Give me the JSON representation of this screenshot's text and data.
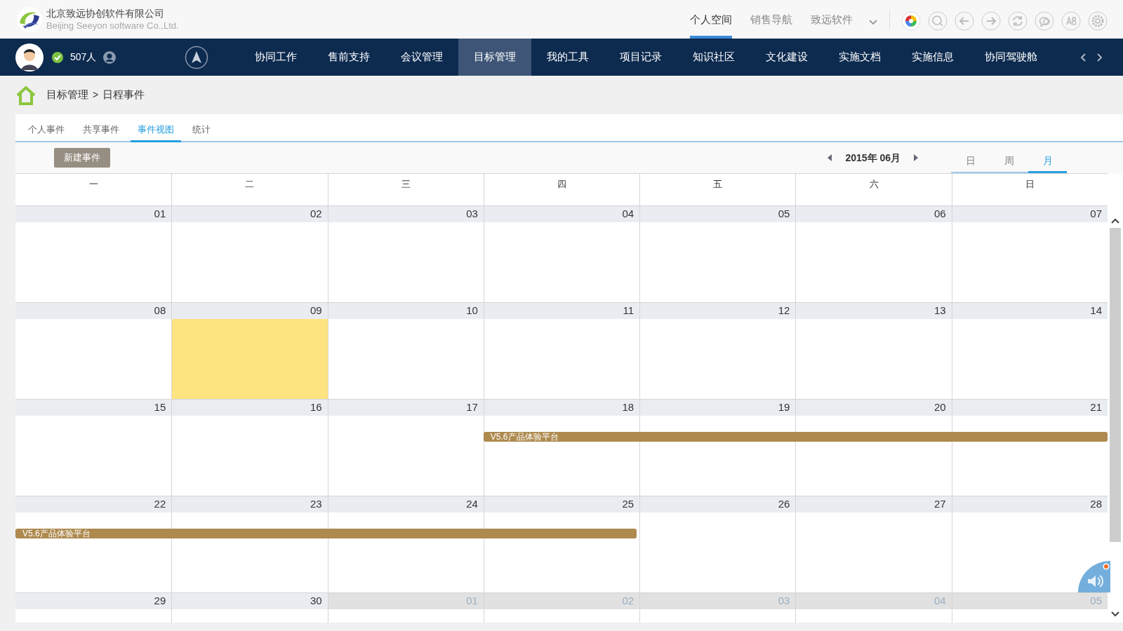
{
  "header": {
    "company": "北京致远协创软件有限公司",
    "company_en": "Beijing Seeyon software Co.,Ltd.",
    "space_tabs": [
      {
        "label": "个人空间",
        "selected": true
      },
      {
        "label": "销售导航",
        "selected": false
      },
      {
        "label": "致远软件",
        "selected": false
      }
    ]
  },
  "user_bar": {
    "online_count": "507人"
  },
  "nav": [
    {
      "label": "协同工作",
      "selected": false
    },
    {
      "label": "售前支持",
      "selected": false
    },
    {
      "label": "会议管理",
      "selected": false
    },
    {
      "label": "目标管理",
      "selected": true
    },
    {
      "label": "我的工具",
      "selected": false
    },
    {
      "label": "项目记录",
      "selected": false
    },
    {
      "label": "知识社区",
      "selected": false
    },
    {
      "label": "文化建设",
      "selected": false
    },
    {
      "label": "实施文档",
      "selected": false
    },
    {
      "label": "实施信息",
      "selected": false
    },
    {
      "label": "协同驾驶舱",
      "selected": false
    }
  ],
  "breadcrumb": {
    "parent": "目标管理",
    "separator": ">",
    "current": "日程事件"
  },
  "tabs": [
    {
      "label": "个人事件",
      "selected": false
    },
    {
      "label": "共享事件",
      "selected": false
    },
    {
      "label": "事件视图",
      "selected": true
    },
    {
      "label": "统计",
      "selected": false
    }
  ],
  "toolbar": {
    "new_button": "新建事件",
    "month": "2015年 06月",
    "views": [
      {
        "label": "日",
        "selected": false
      },
      {
        "label": "周",
        "selected": false
      },
      {
        "label": "月",
        "selected": true
      }
    ]
  },
  "weekdays": [
    "一",
    "二",
    "三",
    "四",
    "五",
    "六",
    "日"
  ],
  "weeks": [
    {
      "days": [
        {
          "label": "01",
          "in_month": true,
          "today": false,
          "event": false
        },
        {
          "label": "02",
          "in_month": true,
          "today": false,
          "event": false
        },
        {
          "label": "03",
          "in_month": true,
          "today": false,
          "event": false
        },
        {
          "label": "04",
          "in_month": true,
          "today": false,
          "event": false
        },
        {
          "label": "05",
          "in_month": true,
          "today": false,
          "event": false
        },
        {
          "label": "06",
          "in_month": true,
          "today": false,
          "event": false
        },
        {
          "label": "07",
          "in_month": true,
          "today": false,
          "event": false
        }
      ]
    },
    {
      "days": [
        {
          "label": "08",
          "in_month": true,
          "today": false,
          "event": false
        },
        {
          "label": "09",
          "in_month": true,
          "today": true,
          "event": false
        },
        {
          "label": "10",
          "in_month": true,
          "today": false,
          "event": false
        },
        {
          "label": "11",
          "in_month": true,
          "today": false,
          "event": false
        },
        {
          "label": "12",
          "in_month": true,
          "today": false,
          "event": false
        },
        {
          "label": "13",
          "in_month": true,
          "today": false,
          "event": false
        },
        {
          "label": "14",
          "in_month": true,
          "today": false,
          "event": false
        }
      ]
    },
    {
      "event_label": "V5.6产品体验平台",
      "days": [
        {
          "label": "15",
          "in_month": true,
          "today": false,
          "event": false
        },
        {
          "label": "16",
          "in_month": true,
          "today": false,
          "event": false
        },
        {
          "label": "17",
          "in_month": true,
          "today": false,
          "event": false
        },
        {
          "label": "18",
          "in_month": true,
          "today": false,
          "event": true
        },
        {
          "label": "19",
          "in_month": true,
          "today": false,
          "event": true
        },
        {
          "label": "20",
          "in_month": true,
          "today": false,
          "event": true
        },
        {
          "label": "21",
          "in_month": true,
          "today": false,
          "event": true
        }
      ]
    },
    {
      "event_label": "V5.6产品体验平台",
      "days": [
        {
          "label": "22",
          "in_month": true,
          "today": false,
          "event": true
        },
        {
          "label": "23",
          "in_month": true,
          "today": false,
          "event": true
        },
        {
          "label": "24",
          "in_month": true,
          "today": false,
          "event": true
        },
        {
          "label": "25",
          "in_month": true,
          "today": false,
          "event": true
        },
        {
          "label": "26",
          "in_month": true,
          "today": false,
          "event": false
        },
        {
          "label": "27",
          "in_month": true,
          "today": false,
          "event": false
        },
        {
          "label": "28",
          "in_month": true,
          "today": false,
          "event": false
        }
      ]
    },
    {
      "days": [
        {
          "label": "29",
          "in_month": true,
          "today": false,
          "event": false
        },
        {
          "label": "30",
          "in_month": true,
          "today": false,
          "event": false
        },
        {
          "label": "01",
          "in_month": false,
          "today": false,
          "event": false
        },
        {
          "label": "02",
          "in_month": false,
          "today": false,
          "event": false
        },
        {
          "label": "03",
          "in_month": false,
          "today": false,
          "event": false
        },
        {
          "label": "04",
          "in_month": false,
          "today": false,
          "event": false
        },
        {
          "label": "05",
          "in_month": false,
          "today": false,
          "event": false
        }
      ]
    }
  ]
}
